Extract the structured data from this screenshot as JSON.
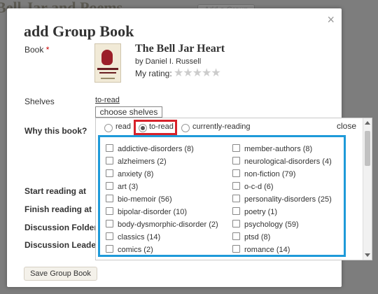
{
  "background": {
    "page_title": "Bell Jar and Poems",
    "button_label": "Add a Group"
  },
  "modal": {
    "title": "add Group Book",
    "close_glyph": "×",
    "labels": {
      "book": "Book",
      "required": "*",
      "shelves": "Shelves",
      "why": "Why this book?",
      "start": "Start reading at",
      "finish": "Finish reading at",
      "folder": "Discussion Folder",
      "leader": "Discussion Leader"
    },
    "book": {
      "title": "The Bell Jar Heart",
      "author": "by Daniel I. Russell",
      "rating_label": "My rating:",
      "stars": "★★★★★"
    },
    "shelf_link": "to-read",
    "choose_shelves": "choose shelves",
    "save_button": "Save Group Book"
  },
  "shelf_popup": {
    "radios": [
      {
        "label": "read",
        "selected": false
      },
      {
        "label": "to-read",
        "selected": true
      },
      {
        "label": "currently-reading",
        "selected": false
      }
    ],
    "close": "close",
    "shelves_left": [
      {
        "name": "addictive-disorders",
        "count": "(8)"
      },
      {
        "name": "alzheimers",
        "count": "(2)"
      },
      {
        "name": "anxiety",
        "count": "(8)"
      },
      {
        "name": "art",
        "count": "(3)"
      },
      {
        "name": "bio-memoir",
        "count": "(56)"
      },
      {
        "name": "bipolar-disorder",
        "count": "(10)"
      },
      {
        "name": "body-dysmorphic-disorder",
        "count": "(2)"
      },
      {
        "name": "classics",
        "count": "(14)"
      },
      {
        "name": "comics",
        "count": "(2)"
      }
    ],
    "shelves_right": [
      {
        "name": "member-authors",
        "count": "(8)"
      },
      {
        "name": "neurological-disorders",
        "count": "(4)"
      },
      {
        "name": "non-fiction",
        "count": "(79)"
      },
      {
        "name": "o-c-d",
        "count": "(6)"
      },
      {
        "name": "personality-disorders",
        "count": "(25)"
      },
      {
        "name": "poetry",
        "count": "(1)"
      },
      {
        "name": "psychology",
        "count": "(59)"
      },
      {
        "name": "ptsd",
        "count": "(8)"
      },
      {
        "name": "romance",
        "count": "(14)"
      }
    ]
  }
}
